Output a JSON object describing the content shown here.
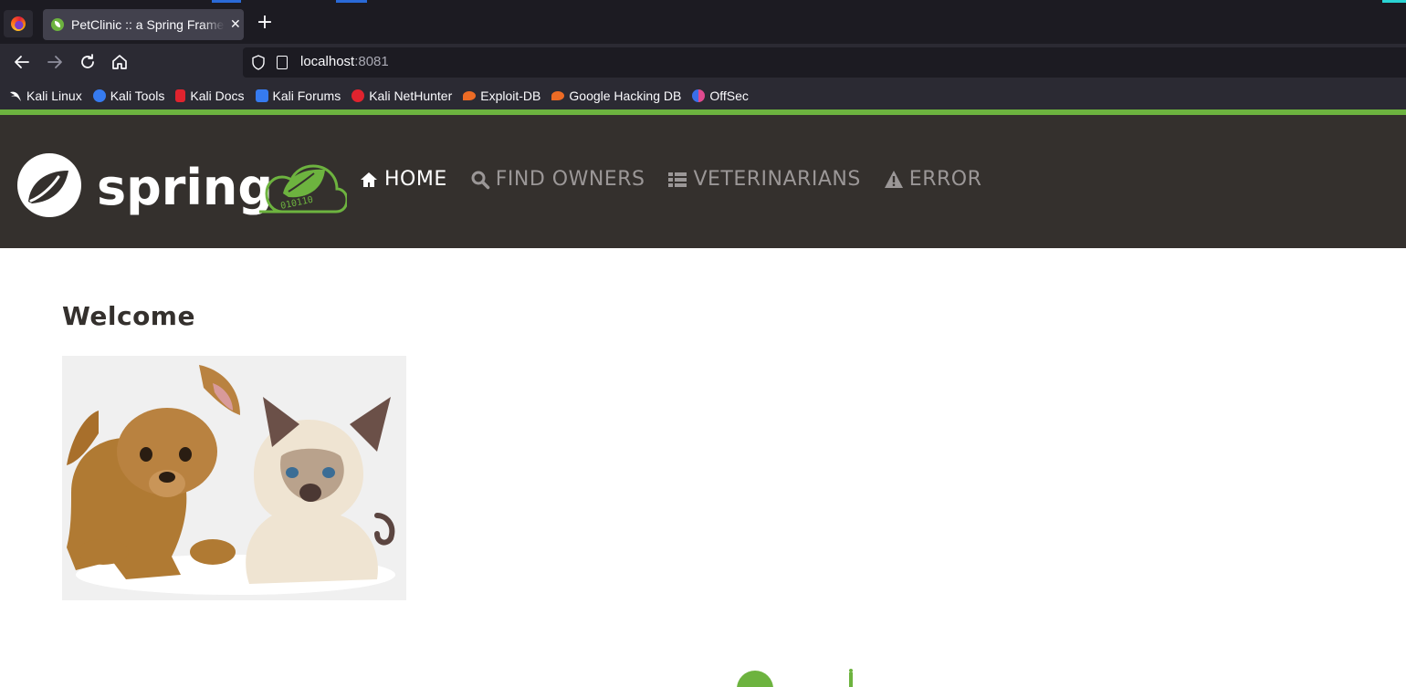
{
  "browser": {
    "tab_title": "PetClinic :: a Spring Framework demonstration",
    "tab_close": "✕",
    "new_tab": "+",
    "url_host": "localhost",
    "url_port": ":8081",
    "bookmarks": [
      {
        "label": "Kali Linux",
        "icon": "kali-dragon-icon",
        "color": "#ffffff"
      },
      {
        "label": "Kali Tools",
        "icon": "kali-tools-icon",
        "color": "#367bf0"
      },
      {
        "label": "Kali Docs",
        "icon": "kali-docs-icon",
        "color": "#e0232e"
      },
      {
        "label": "Kali Forums",
        "icon": "kali-forums-icon",
        "color": "#367bf0"
      },
      {
        "label": "Kali NetHunter",
        "icon": "nethunter-icon",
        "color": "#e0232e"
      },
      {
        "label": "Exploit-DB",
        "icon": "exploit-db-icon",
        "color": "#ec6b25"
      },
      {
        "label": "Google Hacking DB",
        "icon": "ghdb-icon",
        "color": "#ec6b25"
      },
      {
        "label": "OffSec",
        "icon": "offsec-icon",
        "color": "#3a6ee8"
      }
    ]
  },
  "app": {
    "brand_text": "spring",
    "brand_binary": "010110",
    "nav": [
      {
        "label": "HOME",
        "icon": "home-icon",
        "active": true
      },
      {
        "label": "FIND OWNERS",
        "icon": "search-icon",
        "active": false
      },
      {
        "label": "VETERINARIANS",
        "icon": "list-icon",
        "active": false
      },
      {
        "label": "ERROR",
        "icon": "warning-icon",
        "active": false
      }
    ],
    "heading": "Welcome",
    "colors": {
      "accent": "#6db33f",
      "header_bg": "#34302d",
      "nav_inactive": "#9b9797"
    }
  }
}
